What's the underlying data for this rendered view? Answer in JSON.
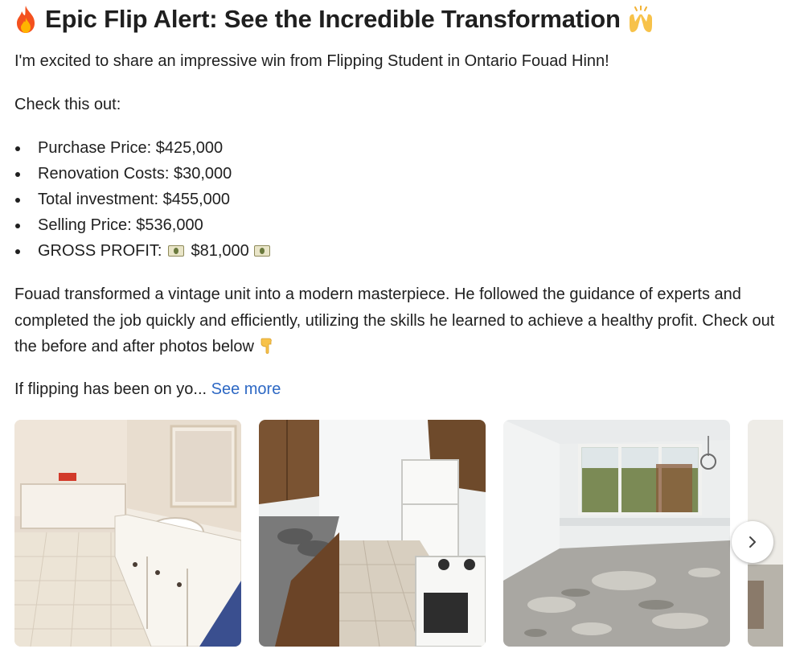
{
  "post": {
    "title": "Epic Flip Alert: See the Incredible Transformation",
    "title_leading_icon": "fire-emoji",
    "title_trailing_icon": "raised-hands-emoji",
    "intro": "I'm excited to share an impressive win from Flipping Student in Ontario Fouad Hinn!",
    "check": "Check this out:",
    "facts": [
      {
        "label": "Purchase Price: $425,000"
      },
      {
        "label": "Renovation Costs: $30,000"
      },
      {
        "label": "Total investment: $455,000"
      },
      {
        "label": "Selling Price: $536,000"
      },
      {
        "label_prefix": "GROSS PROFIT:",
        "value": "$81,000",
        "icon": "money-emoji"
      }
    ],
    "body": "Fouad transformed a vintage unit into a modern masterpiece. He followed the guidance of experts and completed the job quickly and efficiently, utilizing the skills he learned to achieve a healthy profit. Check out the before and after photos below",
    "body_trailing_icon": "pointing-down-emoji",
    "teaser": "If flipping has been on yo...",
    "see_more": "See more"
  },
  "carousel": {
    "photos": [
      "bathroom-before-photo",
      "kitchen-before-photo",
      "living-room-before-photo",
      "partial-next-photo"
    ],
    "next_icon": "chevron-right-icon"
  },
  "colors": {
    "text": "#1f1f1f",
    "link": "#2d68c4"
  }
}
